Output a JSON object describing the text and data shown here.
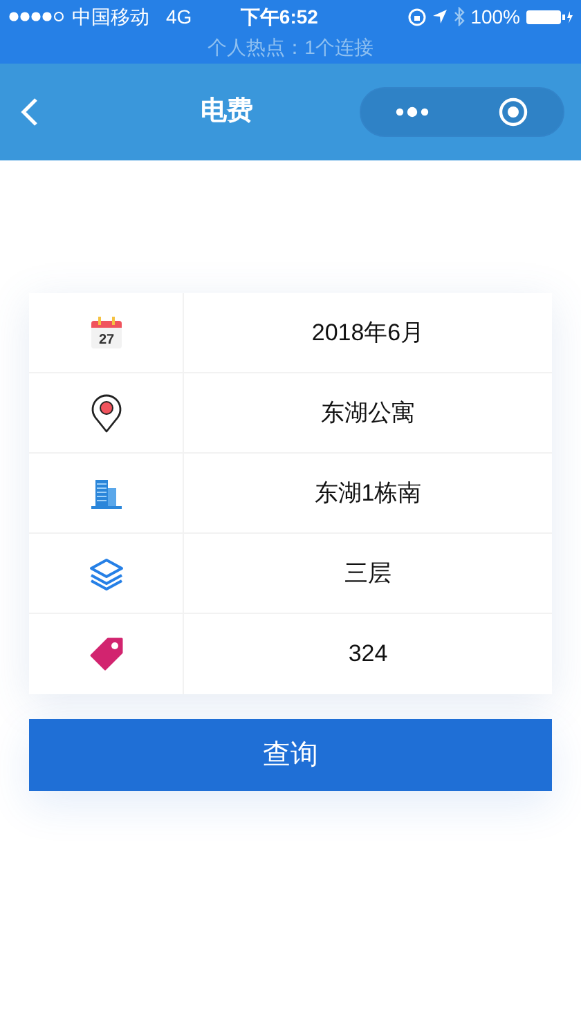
{
  "status_bar": {
    "carrier": "中国移动",
    "network": "4G",
    "time": "下午6:52",
    "battery": "100%",
    "hotspot": "个人热点：1个连接"
  },
  "nav": {
    "title": "电费"
  },
  "fields": [
    {
      "kind": "calendar",
      "icon_text": "27",
      "value": "2018年6月"
    },
    {
      "kind": "location",
      "value": "东湖公寓"
    },
    {
      "kind": "building",
      "value": "东湖1栋南"
    },
    {
      "kind": "layers",
      "value": "三层"
    },
    {
      "kind": "tag",
      "value": "324"
    }
  ],
  "button": {
    "label": "查询"
  }
}
